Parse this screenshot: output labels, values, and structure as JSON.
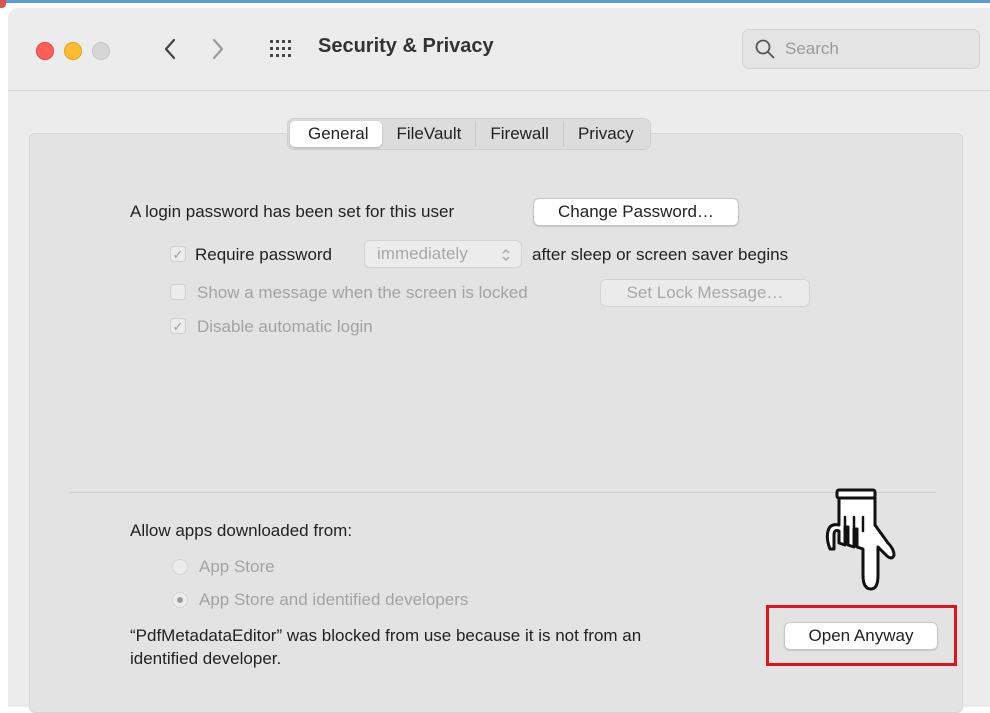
{
  "window": {
    "title": "Security & Privacy",
    "search_placeholder": "Search"
  },
  "tabs": [
    {
      "label": "General",
      "active": true
    },
    {
      "label": "FileVault",
      "active": false
    },
    {
      "label": "Firewall",
      "active": false
    },
    {
      "label": "Privacy",
      "active": false
    }
  ],
  "general": {
    "login_text": "A login password has been set for this user",
    "change_password_label": "Change Password…",
    "require_password_label": "Require password",
    "require_password_checked": true,
    "require_password_delay": "immediately",
    "after_sleep_text": "after sleep or screen saver begins",
    "show_message_label": "Show a message when the screen is locked",
    "show_message_checked": false,
    "set_lock_message_label": "Set Lock Message…",
    "disable_auto_login_label": "Disable automatic login",
    "disable_auto_login_checked": true
  },
  "allow_apps": {
    "heading": "Allow apps downloaded from:",
    "options": [
      {
        "label": "App Store",
        "selected": false
      },
      {
        "label": "App Store and identified developers",
        "selected": true
      }
    ],
    "blocked_line1": "“PdfMetadataEditor” was blocked from use because it is not from an",
    "blocked_line2": "identified developer.",
    "open_anyway_label": "Open Anyway"
  },
  "colors": {
    "highlight_box": "#e0141e",
    "close": "#ff5f57",
    "minimize": "#febc2e"
  }
}
